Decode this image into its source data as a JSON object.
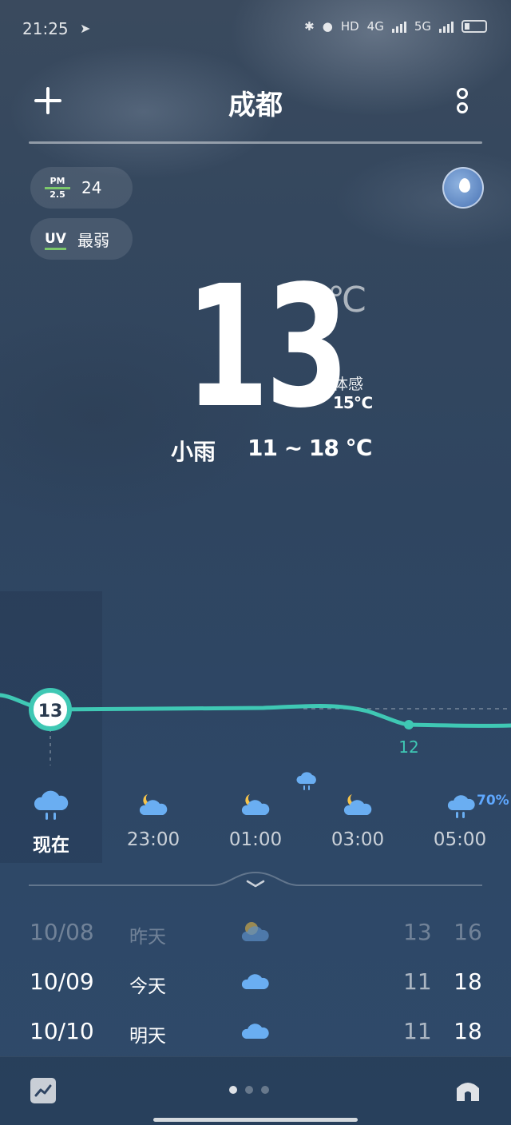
{
  "status_bar": {
    "time": "21:25",
    "network_label": "HD",
    "network_gen_1": "4G",
    "network_gen_2": "5G"
  },
  "header": {
    "city": "成都"
  },
  "air": {
    "pm_label_top": "PM",
    "pm_label_bottom": "2.5",
    "pm_value": "24",
    "uv_label": "UV",
    "uv_value": "最弱",
    "indicator_color": "#7cc86b"
  },
  "current": {
    "temperature": "13",
    "unit": "℃",
    "feels_like_label": "体感",
    "feels_like_value": "15℃",
    "condition": "小雨",
    "range": "11 ~ 18 ℃"
  },
  "hourly": {
    "curve_color": "#3fc8b4",
    "now_temp": "13",
    "min_temp": "12",
    "precip_probability": "70%",
    "items": [
      {
        "time": "现在",
        "icon": "rain-cloud-icon"
      },
      {
        "time": "23:00",
        "icon": "moon-cloud-icon"
      },
      {
        "time": "01:00",
        "icon": "moon-cloud-icon"
      },
      {
        "time": "03:00",
        "icon": "moon-cloud-icon"
      },
      {
        "time": "05:00",
        "icon": "rain-cloud-icon"
      }
    ]
  },
  "daily": [
    {
      "date": "10/08",
      "name": "昨天",
      "icon": "sun-cloud-icon",
      "low": "13",
      "high": "16"
    },
    {
      "date": "10/09",
      "name": "今天",
      "icon": "cloud-icon",
      "low": "11",
      "high": "18"
    },
    {
      "date": "10/10",
      "name": "明天",
      "icon": "cloud-icon",
      "low": "11",
      "high": "18"
    }
  ],
  "colors": {
    "accent_blue": "#5fa8ff",
    "cloud_blue": "#6aaef2"
  }
}
